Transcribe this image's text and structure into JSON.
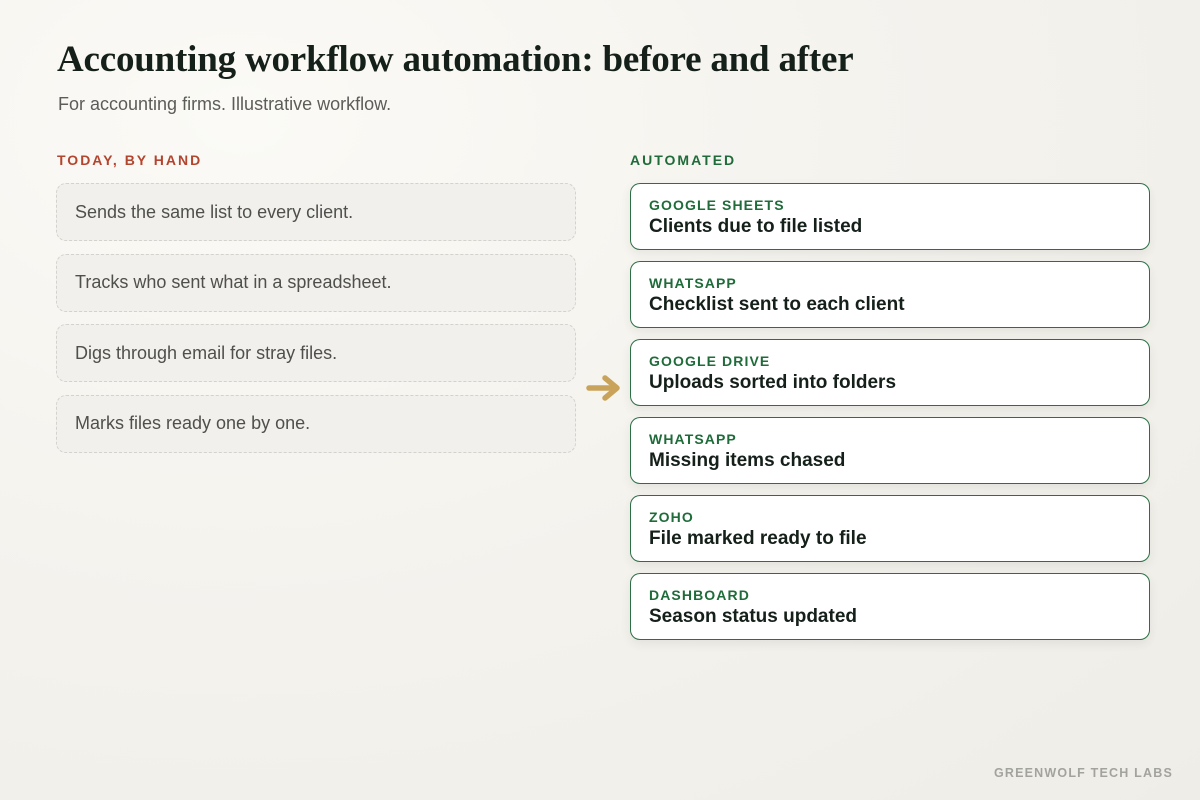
{
  "header": {
    "title": "Accounting workflow automation: before and after",
    "subtitle": "For accounting firms. Illustrative workflow."
  },
  "manual": {
    "heading": "TODAY, BY HAND",
    "items": [
      {
        "text": "Sends the same list to every client."
      },
      {
        "text": "Tracks who sent what in a spreadsheet."
      },
      {
        "text": "Digs through email for stray files."
      },
      {
        "text": "Marks files ready one by one."
      }
    ]
  },
  "automated": {
    "heading": "AUTOMATED",
    "steps": [
      {
        "tool": "GOOGLE SHEETS",
        "step": "Clients due to file listed"
      },
      {
        "tool": "WHATSAPP",
        "step": "Checklist sent to each client"
      },
      {
        "tool": "GOOGLE DRIVE",
        "step": "Uploads sorted into folders"
      },
      {
        "tool": "WHATSAPP",
        "step": "Missing items chased"
      },
      {
        "tool": "ZOHO",
        "step": "File marked ready to file"
      },
      {
        "tool": "DASHBOARD",
        "step": "Season status updated"
      }
    ]
  },
  "footer": {
    "brand": "GREENWOLF TECH LABS"
  },
  "icons": {
    "transition": "arrow-right-icon"
  },
  "colors": {
    "manual_accent": "#b3442e",
    "automated_accent": "#1f6b3a",
    "arrow": "#c9a35a"
  }
}
